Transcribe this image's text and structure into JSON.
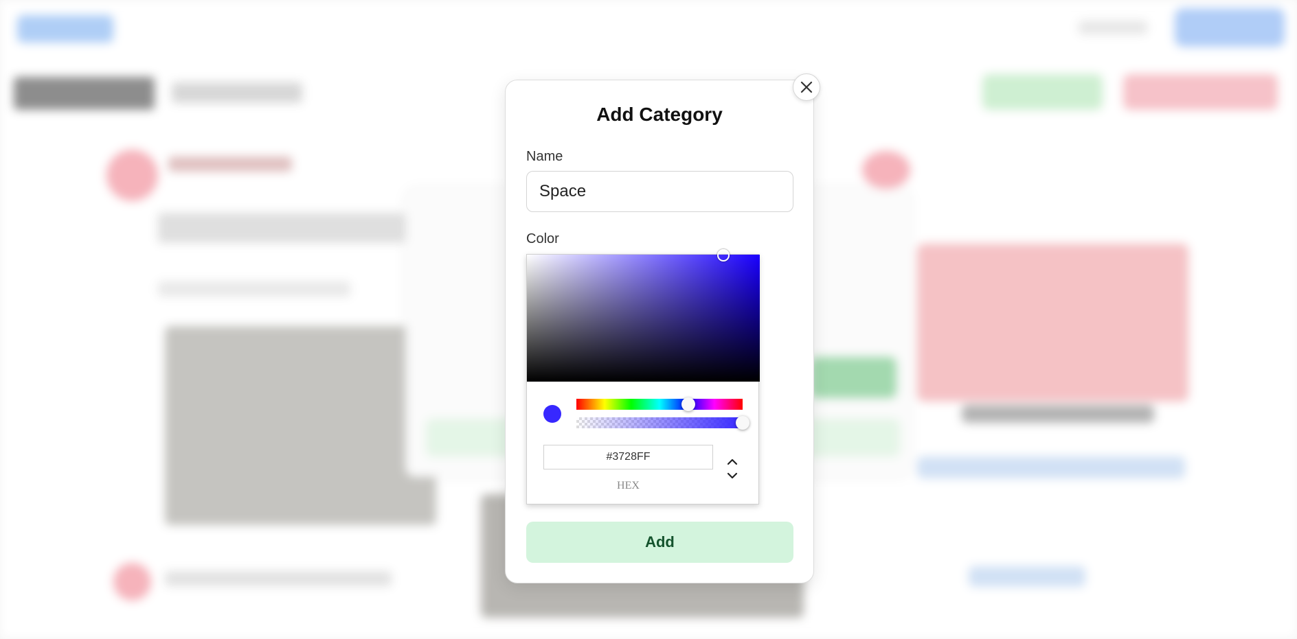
{
  "modal": {
    "title": "Add Category",
    "name_label": "Name",
    "name_value": "Space",
    "color_label": "Color",
    "add_label": "Add"
  },
  "color_picker": {
    "hex_value": "#3728FF",
    "mode_label": "HEX",
    "hue_color": "#1a00ff",
    "selected_color": "#3728ff",
    "hue_position": 0.675,
    "alpha": 1.0
  },
  "icons": {
    "close": "close-icon",
    "mode_up": "chevron-up-icon",
    "mode_down": "chevron-down-icon"
  }
}
